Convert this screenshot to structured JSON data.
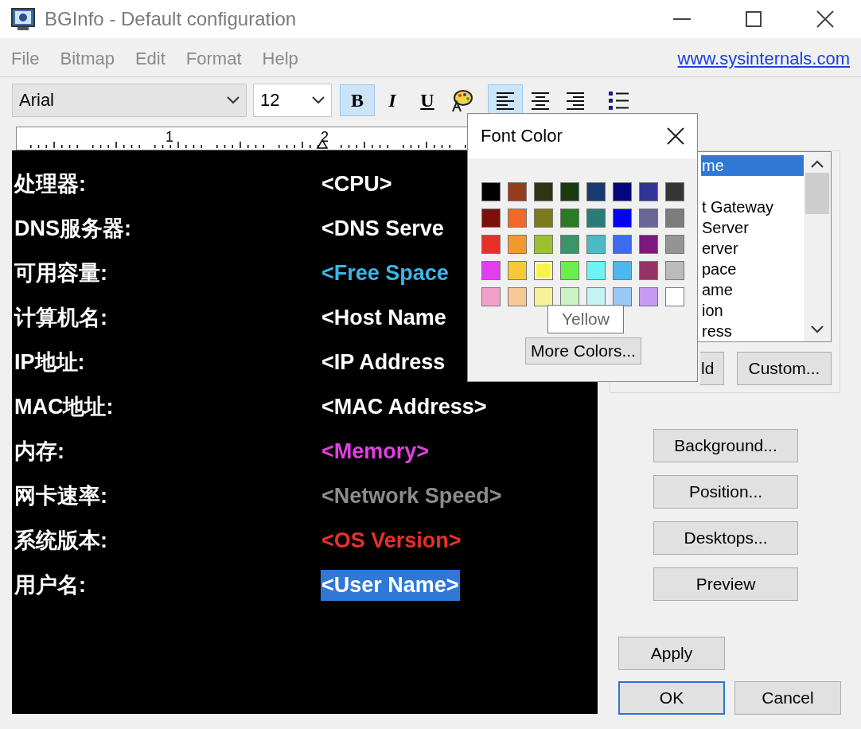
{
  "window": {
    "title": "BGInfo - Default configuration"
  },
  "menu": {
    "items": [
      "File",
      "Bitmap",
      "Edit",
      "Format",
      "Help"
    ],
    "link": "www.sysinternals.com"
  },
  "toolbar": {
    "font": "Arial",
    "size": "12",
    "buttons": [
      {
        "kind": "bold",
        "label": "B",
        "pressed": true
      },
      {
        "kind": "italic",
        "label": "I",
        "pressed": false
      },
      {
        "kind": "underline",
        "label": "U",
        "pressed": false
      },
      {
        "kind": "palette",
        "pressed": false
      },
      {
        "kind": "align-left",
        "pressed": true
      },
      {
        "kind": "align-center",
        "pressed": false
      },
      {
        "kind": "align-right",
        "pressed": false
      },
      {
        "kind": "bullets",
        "pressed": false
      }
    ]
  },
  "ruler": {
    "labels": [
      "1",
      "2"
    ]
  },
  "editor": {
    "rows": [
      {
        "label": "处理器:",
        "value": "<CPU>",
        "color": "#ffffff",
        "selected": false
      },
      {
        "label": "DNS服务器:",
        "value": "<DNS Serve",
        "color": "#ffffff",
        "selected": false
      },
      {
        "label": "可用容量:",
        "value": "<Free Space",
        "color": "#3cb6ea",
        "selected": false
      },
      {
        "label": "计算机名:",
        "value": "<Host Name",
        "color": "#ffffff",
        "selected": false
      },
      {
        "label": "IP地址:",
        "value": "<IP Address",
        "color": "#ffffff",
        "selected": false
      },
      {
        "label": "MAC地址:",
        "value": "<MAC Address>",
        "color": "#ffffff",
        "selected": false
      },
      {
        "label": "内存:",
        "value": "<Memory>",
        "color": "#e33ee3",
        "selected": false
      },
      {
        "label": "网卡速率:",
        "value": "<Network Speed>",
        "color": "#8c8c8c",
        "selected": false
      },
      {
        "label": "系统版本:",
        "value": "<OS Version>",
        "color": "#e8302a",
        "selected": false
      },
      {
        "label": "用户名:",
        "value": "<User Name>",
        "color": "#ffffff",
        "selected": true
      }
    ]
  },
  "fields": {
    "items": [
      {
        "label": "me",
        "selected": true
      },
      {
        "label": "t Gateway",
        "selected": false
      },
      {
        "label": "Server",
        "selected": false
      },
      {
        "label": "erver",
        "selected": false
      },
      {
        "label": "pace",
        "selected": false
      },
      {
        "label": "ame",
        "selected": false
      },
      {
        "label": "ion",
        "selected": false
      },
      {
        "label": "ress",
        "selected": false
      }
    ],
    "buttons": [
      "ld",
      "Custom..."
    ]
  },
  "side_buttons": [
    "Background...",
    "Position...",
    "Desktops...",
    "Preview"
  ],
  "dialog_buttons": [
    {
      "label": "Apply",
      "default": false
    },
    {
      "label": "OK",
      "default": true
    },
    {
      "label": "Cancel",
      "default": false
    }
  ],
  "font_color_popup": {
    "title": "Font Color",
    "swatches": [
      {
        "color": "#000000",
        "highlighted": false
      },
      {
        "color": "#963c1e",
        "highlighted": false
      },
      {
        "color": "#333314",
        "highlighted": false
      },
      {
        "color": "#1a3a12",
        "highlighted": false
      },
      {
        "color": "#173a70",
        "highlighted": false
      },
      {
        "color": "#04067c",
        "highlighted": false
      },
      {
        "color": "#333596",
        "highlighted": false
      },
      {
        "color": "#353535",
        "highlighted": false
      },
      {
        "color": "#7c1008",
        "highlighted": false
      },
      {
        "color": "#ee6a26",
        "highlighted": false
      },
      {
        "color": "#7c7c1c",
        "highlighted": false
      },
      {
        "color": "#2a7c24",
        "highlighted": false
      },
      {
        "color": "#2a7c7a",
        "highlighted": false
      },
      {
        "color": "#0202f4",
        "highlighted": false
      },
      {
        "color": "#6a6696",
        "highlighted": false
      },
      {
        "color": "#7c7c7c",
        "highlighted": false
      },
      {
        "color": "#e8302a",
        "highlighted": false
      },
      {
        "color": "#f09a2c",
        "highlighted": false
      },
      {
        "color": "#9cc032",
        "highlighted": false
      },
      {
        "color": "#3c9468",
        "highlighted": false
      },
      {
        "color": "#4cbac4",
        "highlighted": false
      },
      {
        "color": "#3c6cf0",
        "highlighted": false
      },
      {
        "color": "#7a1a7c",
        "highlighted": false
      },
      {
        "color": "#949494",
        "highlighted": false
      },
      {
        "color": "#e23ef0",
        "highlighted": false
      },
      {
        "color": "#f7c838",
        "highlighted": false
      },
      {
        "color": "#f7f24a",
        "highlighted": true
      },
      {
        "color": "#6aee4a",
        "highlighted": false
      },
      {
        "color": "#6cf3f3",
        "highlighted": false
      },
      {
        "color": "#4cb8ee",
        "highlighted": false
      },
      {
        "color": "#943464",
        "highlighted": false
      },
      {
        "color": "#bcbcbc",
        "highlighted": false
      },
      {
        "color": "#f3a0c8",
        "highlighted": false
      },
      {
        "color": "#f7c898",
        "highlighted": false
      },
      {
        "color": "#f7f29a",
        "highlighted": false
      },
      {
        "color": "#caf3c4",
        "highlighted": false
      },
      {
        "color": "#c4f3f3",
        "highlighted": false
      },
      {
        "color": "#98c8f3",
        "highlighted": false
      },
      {
        "color": "#c49af3",
        "highlighted": false
      },
      {
        "color": "#ffffff",
        "highlighted": false
      }
    ],
    "tooltip": "Yellow",
    "more_button": "More Colors..."
  }
}
